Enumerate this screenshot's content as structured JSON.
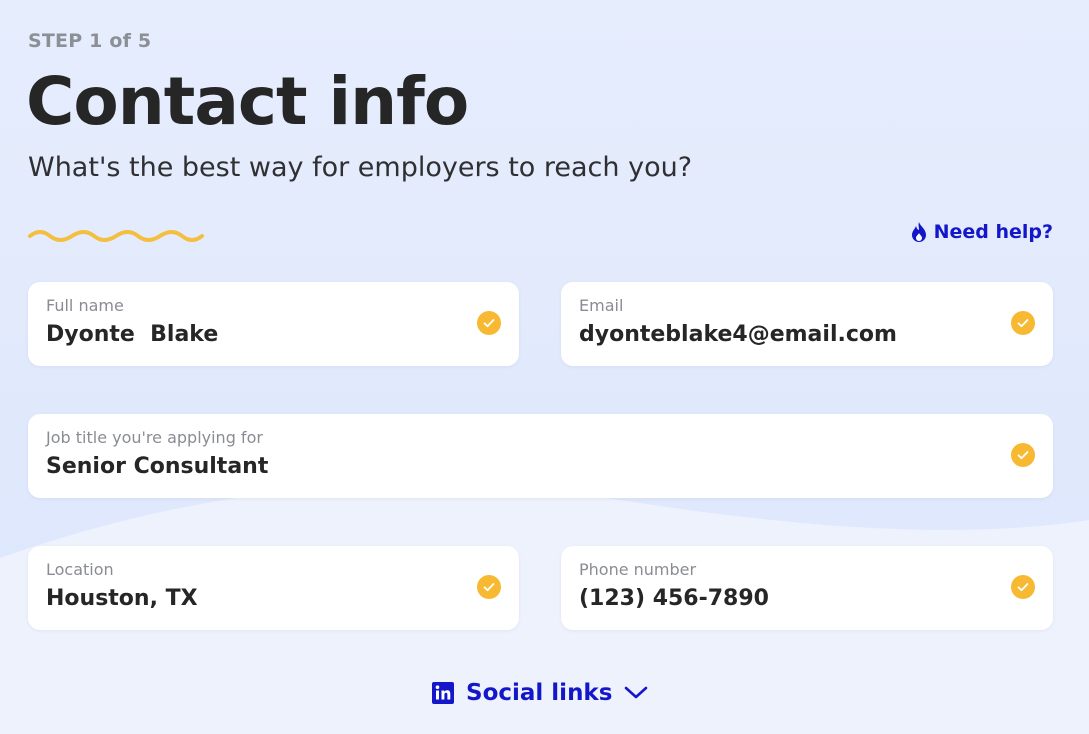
{
  "header": {
    "step": "STEP 1 of 5",
    "title": "Contact info",
    "subtitle": "What's the best way for employers to reach you?"
  },
  "help": {
    "label": "Need help?",
    "icon": "flame-icon"
  },
  "fields": {
    "full_name": {
      "label": "Full name",
      "value": "Dyonte  Blake"
    },
    "email": {
      "label": "Email",
      "value": "dyonteblake4@email.com"
    },
    "job_title": {
      "label": "Job title you're applying for",
      "value": "Senior Consultant"
    },
    "location": {
      "label": "Location",
      "value": "Houston, TX"
    },
    "phone": {
      "label": "Phone number",
      "value": "(123) 456-7890"
    }
  },
  "social": {
    "label": "Social links",
    "icon": "linkedin-icon",
    "chevron": "chevron-down-icon"
  },
  "colors": {
    "accent": "#1317c9",
    "check": "#f7b932",
    "squiggle": "#f4be3e",
    "text": "#262626",
    "muted": "#8a8c94",
    "background": "#e9eefb"
  }
}
